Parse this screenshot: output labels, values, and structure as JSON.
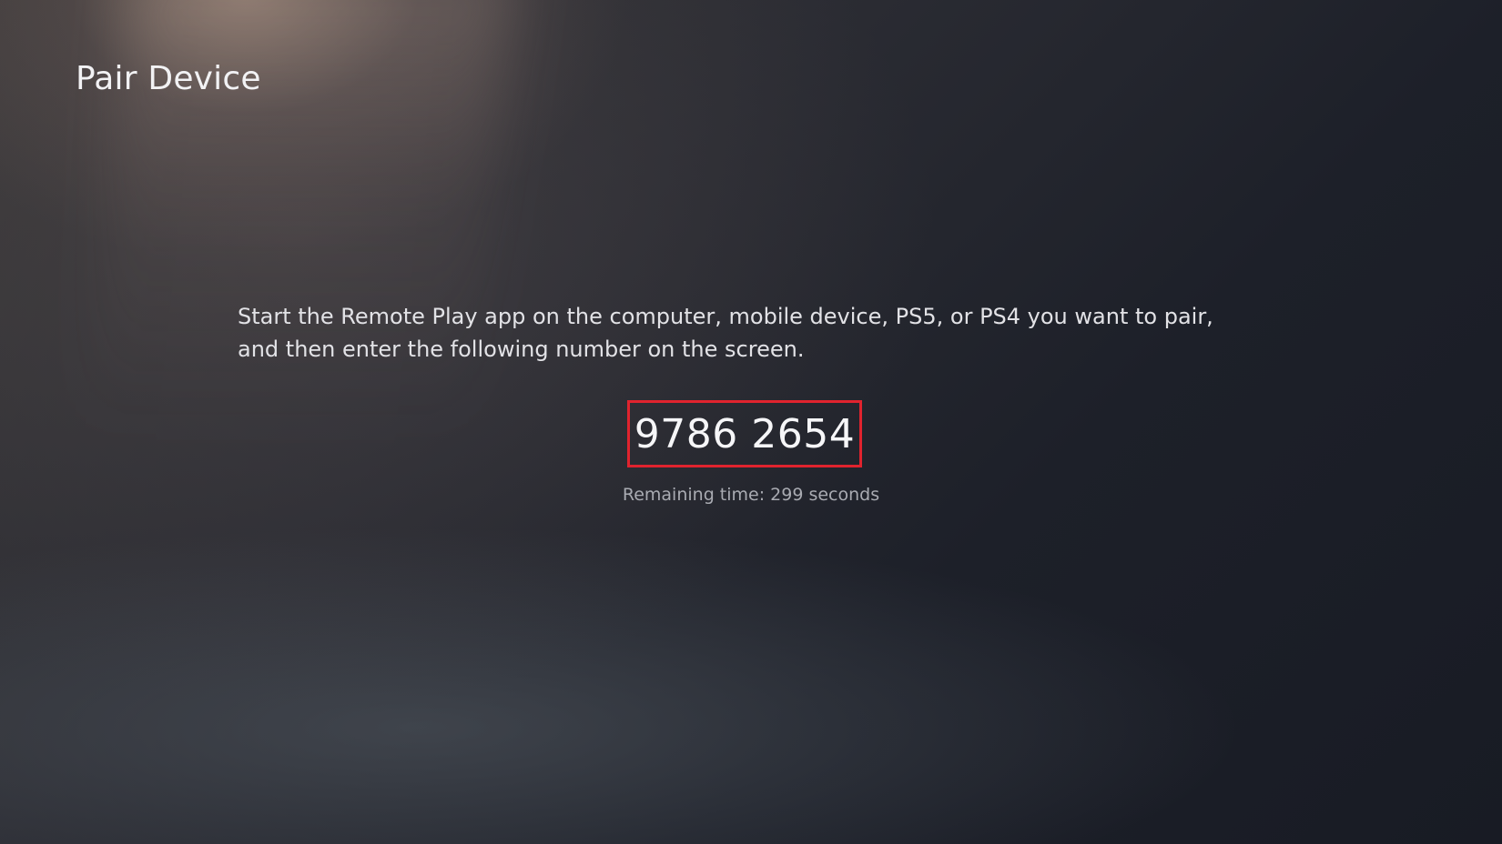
{
  "header": {
    "title": "Pair Device"
  },
  "main": {
    "instructions": "Start the Remote Play app on the computer, mobile device, PS5, or PS4 you want to pair, and then enter the following number on the screen.",
    "pairing_code": "9786 2654",
    "remaining_time": "Remaining time: 299 seconds"
  },
  "colors": {
    "highlight_border": "#e0232e",
    "text_primary": "#f2f2f4",
    "text_secondary": "#a9abb2"
  }
}
